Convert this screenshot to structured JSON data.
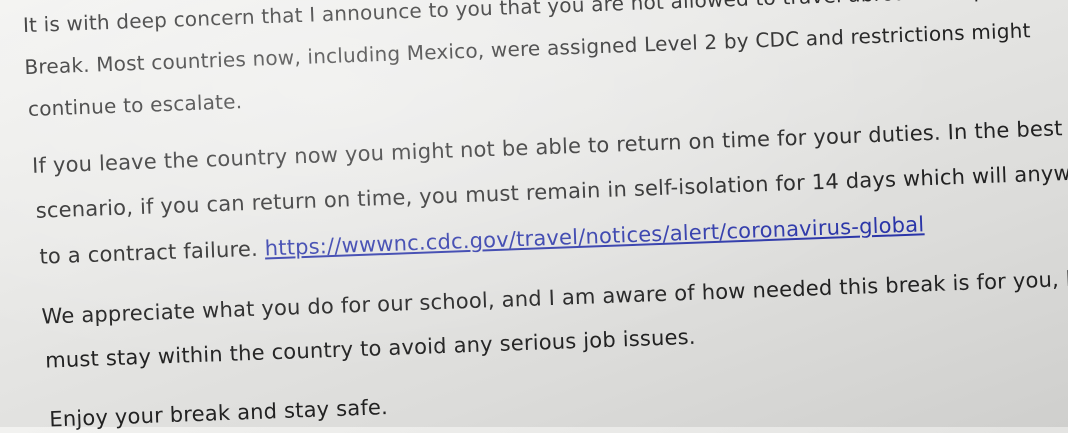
{
  "email": {
    "paragraph1": {
      "line1": "It is with deep concern that I announce to you that you are not allowed to travel abroad for Spring",
      "line2": "Break. Most countries now, including Mexico, were assigned Level 2 by CDC and restrictions might",
      "line3": "continue to escalate."
    },
    "paragraph2": {
      "line1": "If you leave the country now you might not be able to return on time for your duties. In the best",
      "line2": "scenario, if you can return on time, you must remain in self-isolation for 14 days which will anyways lea",
      "line3_text": "to a contract failure. ",
      "line3_link": "https://wwwnc.cdc.gov/travel/notices/alert/coronavirus-global"
    },
    "paragraph3": {
      "line1": "We appreciate what you do for our school, and I am aware of how needed this break is for you, but yo",
      "line2": "must stay within the country to avoid any serious job issues."
    },
    "closing": "Enjoy your break and stay safe."
  },
  "colors": {
    "text": "#222222",
    "link": "#2a35a8",
    "background": "#e8e8e6"
  }
}
